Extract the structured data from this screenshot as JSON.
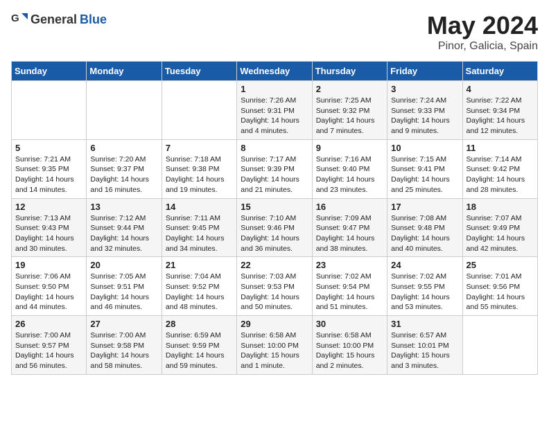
{
  "header": {
    "logo_general": "General",
    "logo_blue": "Blue",
    "title": "May 2024",
    "location": "Pinor, Galicia, Spain"
  },
  "days_of_week": [
    "Sunday",
    "Monday",
    "Tuesday",
    "Wednesday",
    "Thursday",
    "Friday",
    "Saturday"
  ],
  "weeks": [
    [
      {
        "day": "",
        "sunrise": "",
        "sunset": "",
        "daylight": ""
      },
      {
        "day": "",
        "sunrise": "",
        "sunset": "",
        "daylight": ""
      },
      {
        "day": "",
        "sunrise": "",
        "sunset": "",
        "daylight": ""
      },
      {
        "day": "1",
        "sunrise": "Sunrise: 7:26 AM",
        "sunset": "Sunset: 9:31 PM",
        "daylight": "Daylight: 14 hours and 4 minutes."
      },
      {
        "day": "2",
        "sunrise": "Sunrise: 7:25 AM",
        "sunset": "Sunset: 9:32 PM",
        "daylight": "Daylight: 14 hours and 7 minutes."
      },
      {
        "day": "3",
        "sunrise": "Sunrise: 7:24 AM",
        "sunset": "Sunset: 9:33 PM",
        "daylight": "Daylight: 14 hours and 9 minutes."
      },
      {
        "day": "4",
        "sunrise": "Sunrise: 7:22 AM",
        "sunset": "Sunset: 9:34 PM",
        "daylight": "Daylight: 14 hours and 12 minutes."
      }
    ],
    [
      {
        "day": "5",
        "sunrise": "Sunrise: 7:21 AM",
        "sunset": "Sunset: 9:35 PM",
        "daylight": "Daylight: 14 hours and 14 minutes."
      },
      {
        "day": "6",
        "sunrise": "Sunrise: 7:20 AM",
        "sunset": "Sunset: 9:37 PM",
        "daylight": "Daylight: 14 hours and 16 minutes."
      },
      {
        "day": "7",
        "sunrise": "Sunrise: 7:18 AM",
        "sunset": "Sunset: 9:38 PM",
        "daylight": "Daylight: 14 hours and 19 minutes."
      },
      {
        "day": "8",
        "sunrise": "Sunrise: 7:17 AM",
        "sunset": "Sunset: 9:39 PM",
        "daylight": "Daylight: 14 hours and 21 minutes."
      },
      {
        "day": "9",
        "sunrise": "Sunrise: 7:16 AM",
        "sunset": "Sunset: 9:40 PM",
        "daylight": "Daylight: 14 hours and 23 minutes."
      },
      {
        "day": "10",
        "sunrise": "Sunrise: 7:15 AM",
        "sunset": "Sunset: 9:41 PM",
        "daylight": "Daylight: 14 hours and 25 minutes."
      },
      {
        "day": "11",
        "sunrise": "Sunrise: 7:14 AM",
        "sunset": "Sunset: 9:42 PM",
        "daylight": "Daylight: 14 hours and 28 minutes."
      }
    ],
    [
      {
        "day": "12",
        "sunrise": "Sunrise: 7:13 AM",
        "sunset": "Sunset: 9:43 PM",
        "daylight": "Daylight: 14 hours and 30 minutes."
      },
      {
        "day": "13",
        "sunrise": "Sunrise: 7:12 AM",
        "sunset": "Sunset: 9:44 PM",
        "daylight": "Daylight: 14 hours and 32 minutes."
      },
      {
        "day": "14",
        "sunrise": "Sunrise: 7:11 AM",
        "sunset": "Sunset: 9:45 PM",
        "daylight": "Daylight: 14 hours and 34 minutes."
      },
      {
        "day": "15",
        "sunrise": "Sunrise: 7:10 AM",
        "sunset": "Sunset: 9:46 PM",
        "daylight": "Daylight: 14 hours and 36 minutes."
      },
      {
        "day": "16",
        "sunrise": "Sunrise: 7:09 AM",
        "sunset": "Sunset: 9:47 PM",
        "daylight": "Daylight: 14 hours and 38 minutes."
      },
      {
        "day": "17",
        "sunrise": "Sunrise: 7:08 AM",
        "sunset": "Sunset: 9:48 PM",
        "daylight": "Daylight: 14 hours and 40 minutes."
      },
      {
        "day": "18",
        "sunrise": "Sunrise: 7:07 AM",
        "sunset": "Sunset: 9:49 PM",
        "daylight": "Daylight: 14 hours and 42 minutes."
      }
    ],
    [
      {
        "day": "19",
        "sunrise": "Sunrise: 7:06 AM",
        "sunset": "Sunset: 9:50 PM",
        "daylight": "Daylight: 14 hours and 44 minutes."
      },
      {
        "day": "20",
        "sunrise": "Sunrise: 7:05 AM",
        "sunset": "Sunset: 9:51 PM",
        "daylight": "Daylight: 14 hours and 46 minutes."
      },
      {
        "day": "21",
        "sunrise": "Sunrise: 7:04 AM",
        "sunset": "Sunset: 9:52 PM",
        "daylight": "Daylight: 14 hours and 48 minutes."
      },
      {
        "day": "22",
        "sunrise": "Sunrise: 7:03 AM",
        "sunset": "Sunset: 9:53 PM",
        "daylight": "Daylight: 14 hours and 50 minutes."
      },
      {
        "day": "23",
        "sunrise": "Sunrise: 7:02 AM",
        "sunset": "Sunset: 9:54 PM",
        "daylight": "Daylight: 14 hours and 51 minutes."
      },
      {
        "day": "24",
        "sunrise": "Sunrise: 7:02 AM",
        "sunset": "Sunset: 9:55 PM",
        "daylight": "Daylight: 14 hours and 53 minutes."
      },
      {
        "day": "25",
        "sunrise": "Sunrise: 7:01 AM",
        "sunset": "Sunset: 9:56 PM",
        "daylight": "Daylight: 14 hours and 55 minutes."
      }
    ],
    [
      {
        "day": "26",
        "sunrise": "Sunrise: 7:00 AM",
        "sunset": "Sunset: 9:57 PM",
        "daylight": "Daylight: 14 hours and 56 minutes."
      },
      {
        "day": "27",
        "sunrise": "Sunrise: 7:00 AM",
        "sunset": "Sunset: 9:58 PM",
        "daylight": "Daylight: 14 hours and 58 minutes."
      },
      {
        "day": "28",
        "sunrise": "Sunrise: 6:59 AM",
        "sunset": "Sunset: 9:59 PM",
        "daylight": "Daylight: 14 hours and 59 minutes."
      },
      {
        "day": "29",
        "sunrise": "Sunrise: 6:58 AM",
        "sunset": "Sunset: 10:00 PM",
        "daylight": "Daylight: 15 hours and 1 minute."
      },
      {
        "day": "30",
        "sunrise": "Sunrise: 6:58 AM",
        "sunset": "Sunset: 10:00 PM",
        "daylight": "Daylight: 15 hours and 2 minutes."
      },
      {
        "day": "31",
        "sunrise": "Sunrise: 6:57 AM",
        "sunset": "Sunset: 10:01 PM",
        "daylight": "Daylight: 15 hours and 3 minutes."
      },
      {
        "day": "",
        "sunrise": "",
        "sunset": "",
        "daylight": ""
      }
    ]
  ]
}
